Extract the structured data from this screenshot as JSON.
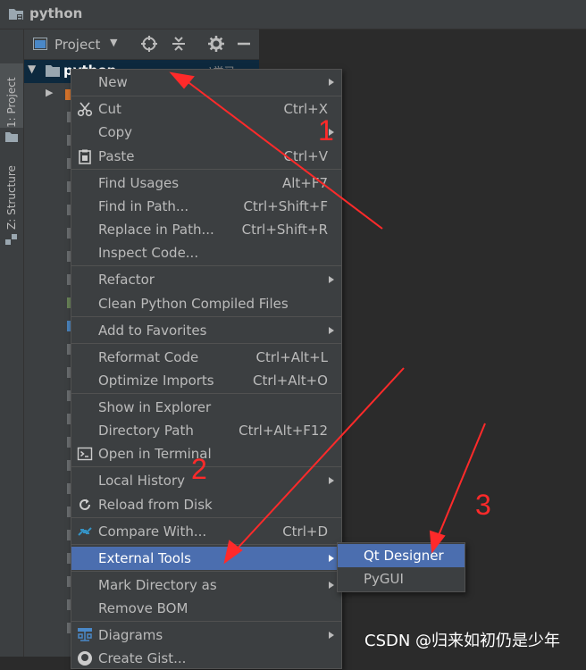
{
  "window": {
    "title": "python"
  },
  "sidebar": {
    "tabs": [
      "1: Project",
      "Z: Structure"
    ]
  },
  "project_panel": {
    "label": "Project",
    "root_name": "python",
    "root_hint": "...\\学习"
  },
  "context_menu": {
    "items": [
      {
        "label": "New",
        "shortcut": "",
        "submenu": true
      },
      {
        "label": "Cut",
        "shortcut": "Ctrl+X",
        "icon": "scissors-icon"
      },
      {
        "label": "Copy",
        "shortcut": ""
      },
      {
        "label": "Paste",
        "shortcut": "Ctrl+V",
        "icon": "clipboard-icon"
      },
      {
        "label": "Find Usages",
        "shortcut": "Alt+F7"
      },
      {
        "label": "Find in Path...",
        "shortcut": "Ctrl+Shift+F"
      },
      {
        "label": "Replace in Path...",
        "shortcut": "Ctrl+Shift+R"
      },
      {
        "label": "Inspect Code...",
        "shortcut": ""
      },
      {
        "label": "Refactor",
        "shortcut": "",
        "submenu": true
      },
      {
        "label": "Clean Python Compiled Files",
        "shortcut": ""
      },
      {
        "label": "Add to Favorites",
        "shortcut": "",
        "submenu": true
      },
      {
        "label": "Reformat Code",
        "shortcut": "Ctrl+Alt+L"
      },
      {
        "label": "Optimize Imports",
        "shortcut": "Ctrl+Alt+O"
      },
      {
        "label": "Show in Explorer",
        "shortcut": ""
      },
      {
        "label": "Directory Path",
        "shortcut": "Ctrl+Alt+F12"
      },
      {
        "label": "Open in Terminal",
        "shortcut": "",
        "icon": "terminal-icon"
      },
      {
        "label": "Local History",
        "shortcut": "",
        "submenu": true
      },
      {
        "label": "Reload from Disk",
        "shortcut": "",
        "icon": "reload-icon"
      },
      {
        "label": "Compare With...",
        "shortcut": "Ctrl+D",
        "icon": "compare-icon"
      },
      {
        "label": "External Tools",
        "shortcut": "",
        "submenu": true,
        "highlighted": true
      },
      {
        "label": "Mark Directory as",
        "shortcut": "",
        "submenu": true
      },
      {
        "label": "Remove BOM",
        "shortcut": ""
      },
      {
        "label": "Diagrams",
        "shortcut": "",
        "submenu": true,
        "icon": "diagram-icon"
      },
      {
        "label": "Create Gist...",
        "shortcut": "",
        "icon": "github-icon"
      }
    ]
  },
  "external_tools_submenu": {
    "items": [
      "Qt Designer",
      "PyGUI"
    ]
  },
  "annotations": {
    "labels": [
      "1",
      "2",
      "3"
    ],
    "color": "#ff2a2a"
  },
  "watermark": "CSDN @归来如初仍是少年",
  "colors": {
    "menu_bg": "#3c3f41",
    "highlight": "#4b6eaf",
    "editor_bg": "#2b2b2b"
  }
}
